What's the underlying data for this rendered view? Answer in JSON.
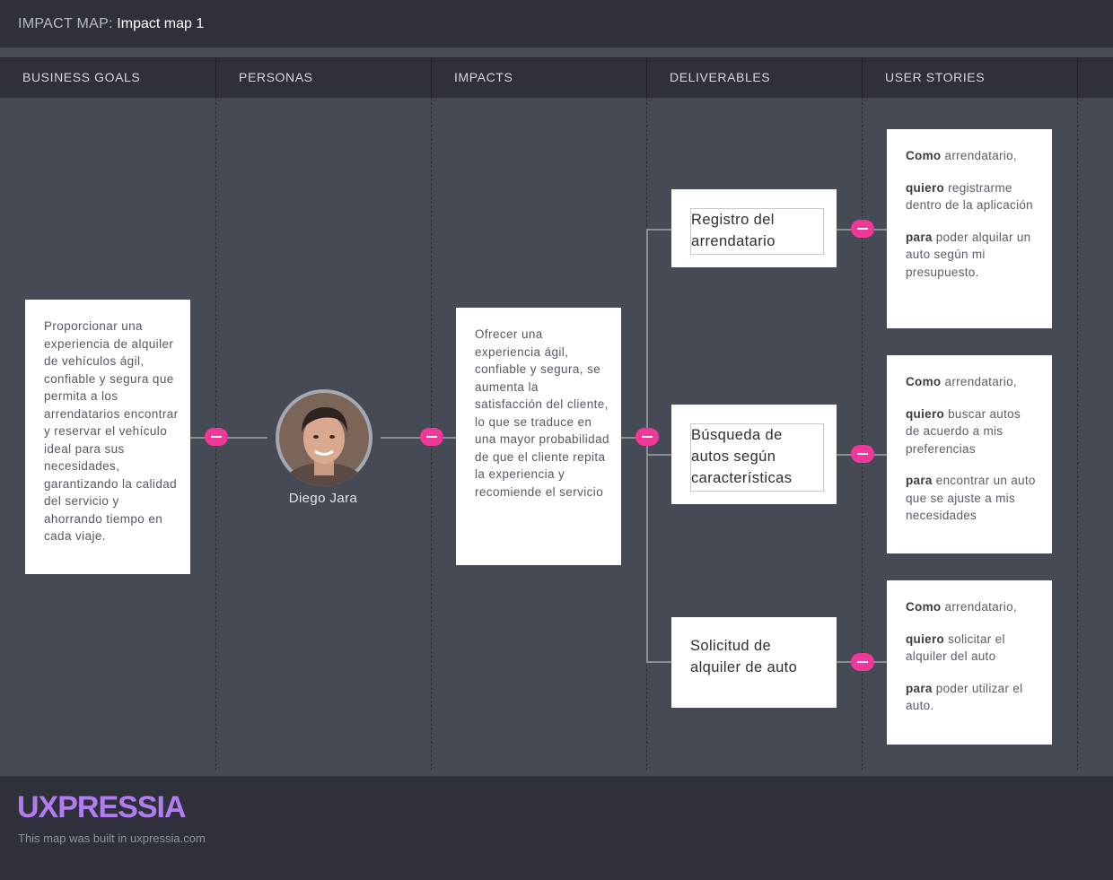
{
  "header": {
    "prefix": "IMPACT MAP:",
    "title": "Impact map 1"
  },
  "columns": [
    "BUSINESS GOALS",
    "PERSONAS",
    "IMPACTS",
    "DELIVERABLES",
    "USER STORIES"
  ],
  "goal": {
    "text": "Proporcionar una experiencia de alquiler de vehículos ágil, confiable y segura que permita a los arrendatarios encontrar y reservar el vehículo ideal para sus necesidades, garantizando la calidad del servicio y ahorrando tiempo en cada viaje."
  },
  "persona": {
    "name": "Diego Jara"
  },
  "impact": {
    "text": "Ofrecer una experiencia ágil, confiable y segura, se aumenta la satisfacción del cliente, lo que se traduce en una mayor probabilidad de que el cliente repita la experiencia y recomiende el servicio"
  },
  "deliverables": [
    {
      "text": "Registro del arrendatario"
    },
    {
      "text": "Búsqueda de autos según características"
    },
    {
      "text": "Solicitud de alquiler de auto"
    }
  ],
  "stories": [
    {
      "como_kw": "Como",
      "como": "arrendatario,",
      "quiero_kw": "quiero",
      "quiero": "registrarme dentro de la aplicación",
      "para_kw": "para",
      "para": "poder alquilar un auto según mi presupuesto."
    },
    {
      "como_kw": "Como",
      "como": "arrendatario,",
      "quiero_kw": "quiero",
      "quiero": "buscar autos de acuerdo a mis preferencias",
      "para_kw": "para",
      "para": "encontrar un auto que se ajuste a mis necesidades"
    },
    {
      "como_kw": "Como",
      "como": "arrendatario,",
      "quiero_kw": "quiero",
      "quiero": "solicitar el alquiler del auto",
      "para_kw": "para",
      "para": "poder utilizar el auto."
    }
  ],
  "footer": {
    "brand": "UXPRESSIA",
    "built": "This map was built in uxpressia.com"
  },
  "colors": {
    "accent": "#f0389a",
    "brand": "#b27bf0",
    "canvas": "#464a54",
    "bar": "#2e313a"
  }
}
